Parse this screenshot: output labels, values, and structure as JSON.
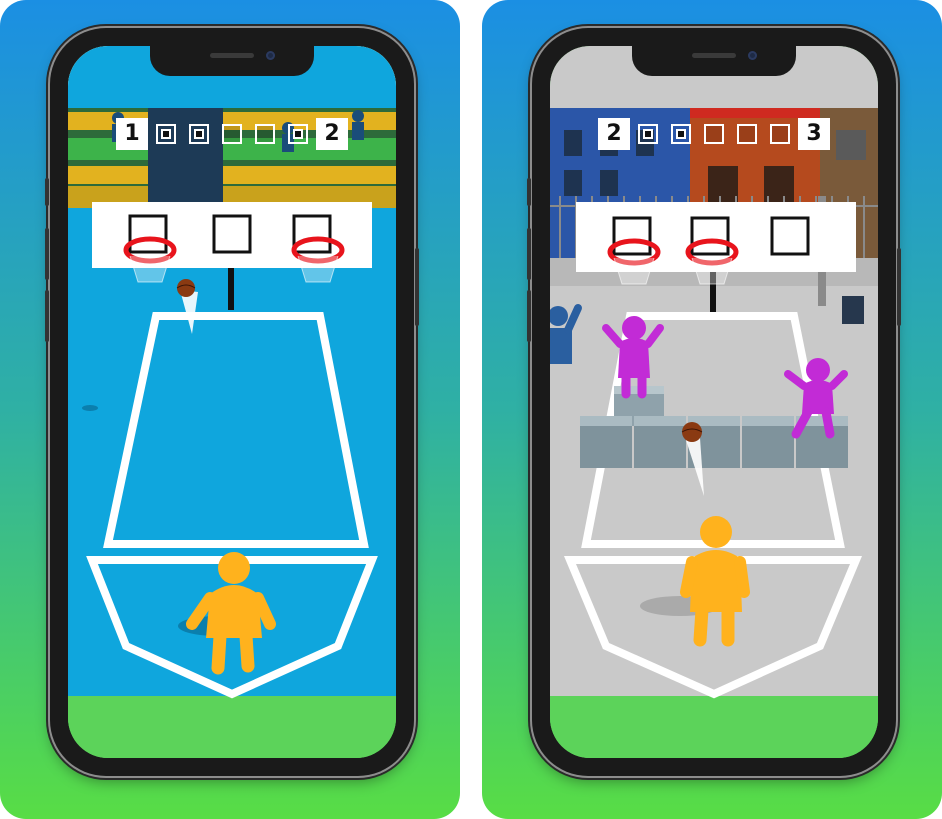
{
  "panels": [
    {
      "id": "blue-court",
      "score_left": "1",
      "score_right": "2",
      "slots": [
        "filled",
        "filled",
        "empty",
        "empty",
        "empty"
      ],
      "court_color": "#0fa6dd",
      "background_top": "#1b8fe3",
      "background_bottom": "#58dd45"
    },
    {
      "id": "street-court",
      "score_left": "2",
      "score_right": "3",
      "slots": [
        "filled",
        "filled",
        "empty",
        "empty",
        "empty"
      ],
      "court_color": "#c9c9c9",
      "background_top": "#1b8fe3",
      "background_bottom": "#58dd45"
    }
  ],
  "colors": {
    "player": "#ffb21d",
    "opponent": "#c22bd6",
    "hoop_rim": "#e8141c",
    "ball": "#8a3a12",
    "court_line": "#ffffff"
  }
}
